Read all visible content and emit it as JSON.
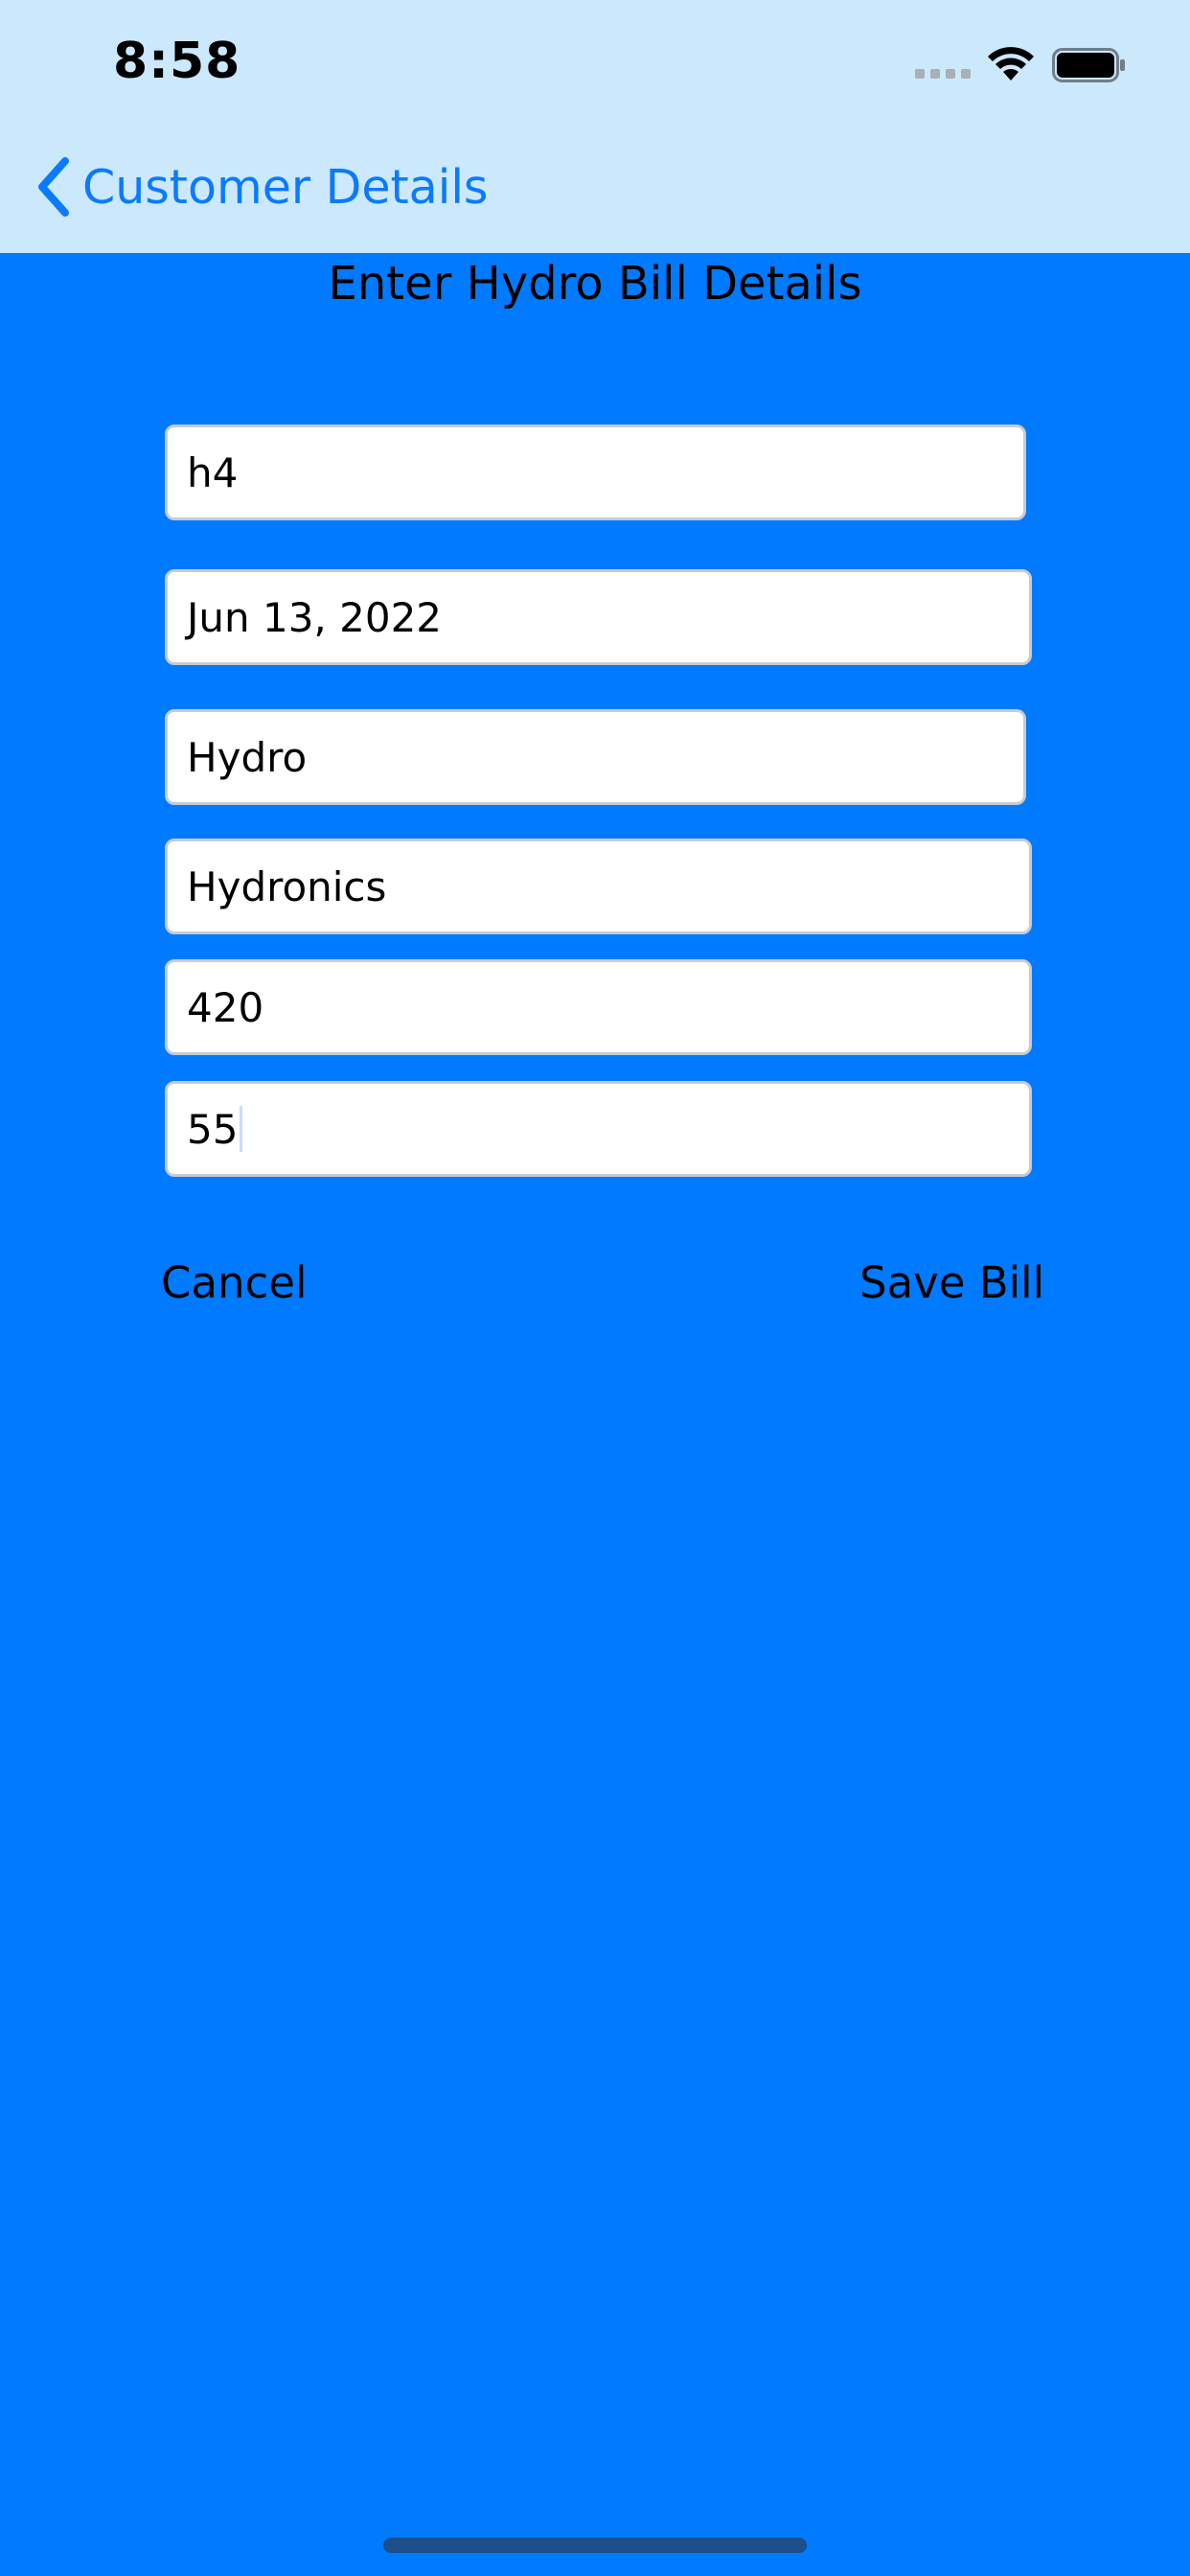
{
  "status_bar": {
    "time": "8:58",
    "signal_icon": "cellular-signal-icon",
    "wifi_icon": "wifi-icon",
    "battery_icon": "battery-icon"
  },
  "nav": {
    "back_icon": "chevron-left-icon",
    "back_label": "Customer Details"
  },
  "page": {
    "title": "Enter Hydro Bill Details"
  },
  "form": {
    "fields": [
      {
        "value": "h4"
      },
      {
        "value": "Jun 13, 2022"
      },
      {
        "value": "Hydro"
      },
      {
        "value": "Hydronics"
      },
      {
        "value": "420"
      },
      {
        "value": "55"
      }
    ]
  },
  "actions": {
    "cancel_label": "Cancel",
    "save_label": "Save Bill"
  },
  "colors": {
    "background": "#007AFF",
    "header_background": "#CBE8FC",
    "link": "#0A7AFF"
  }
}
